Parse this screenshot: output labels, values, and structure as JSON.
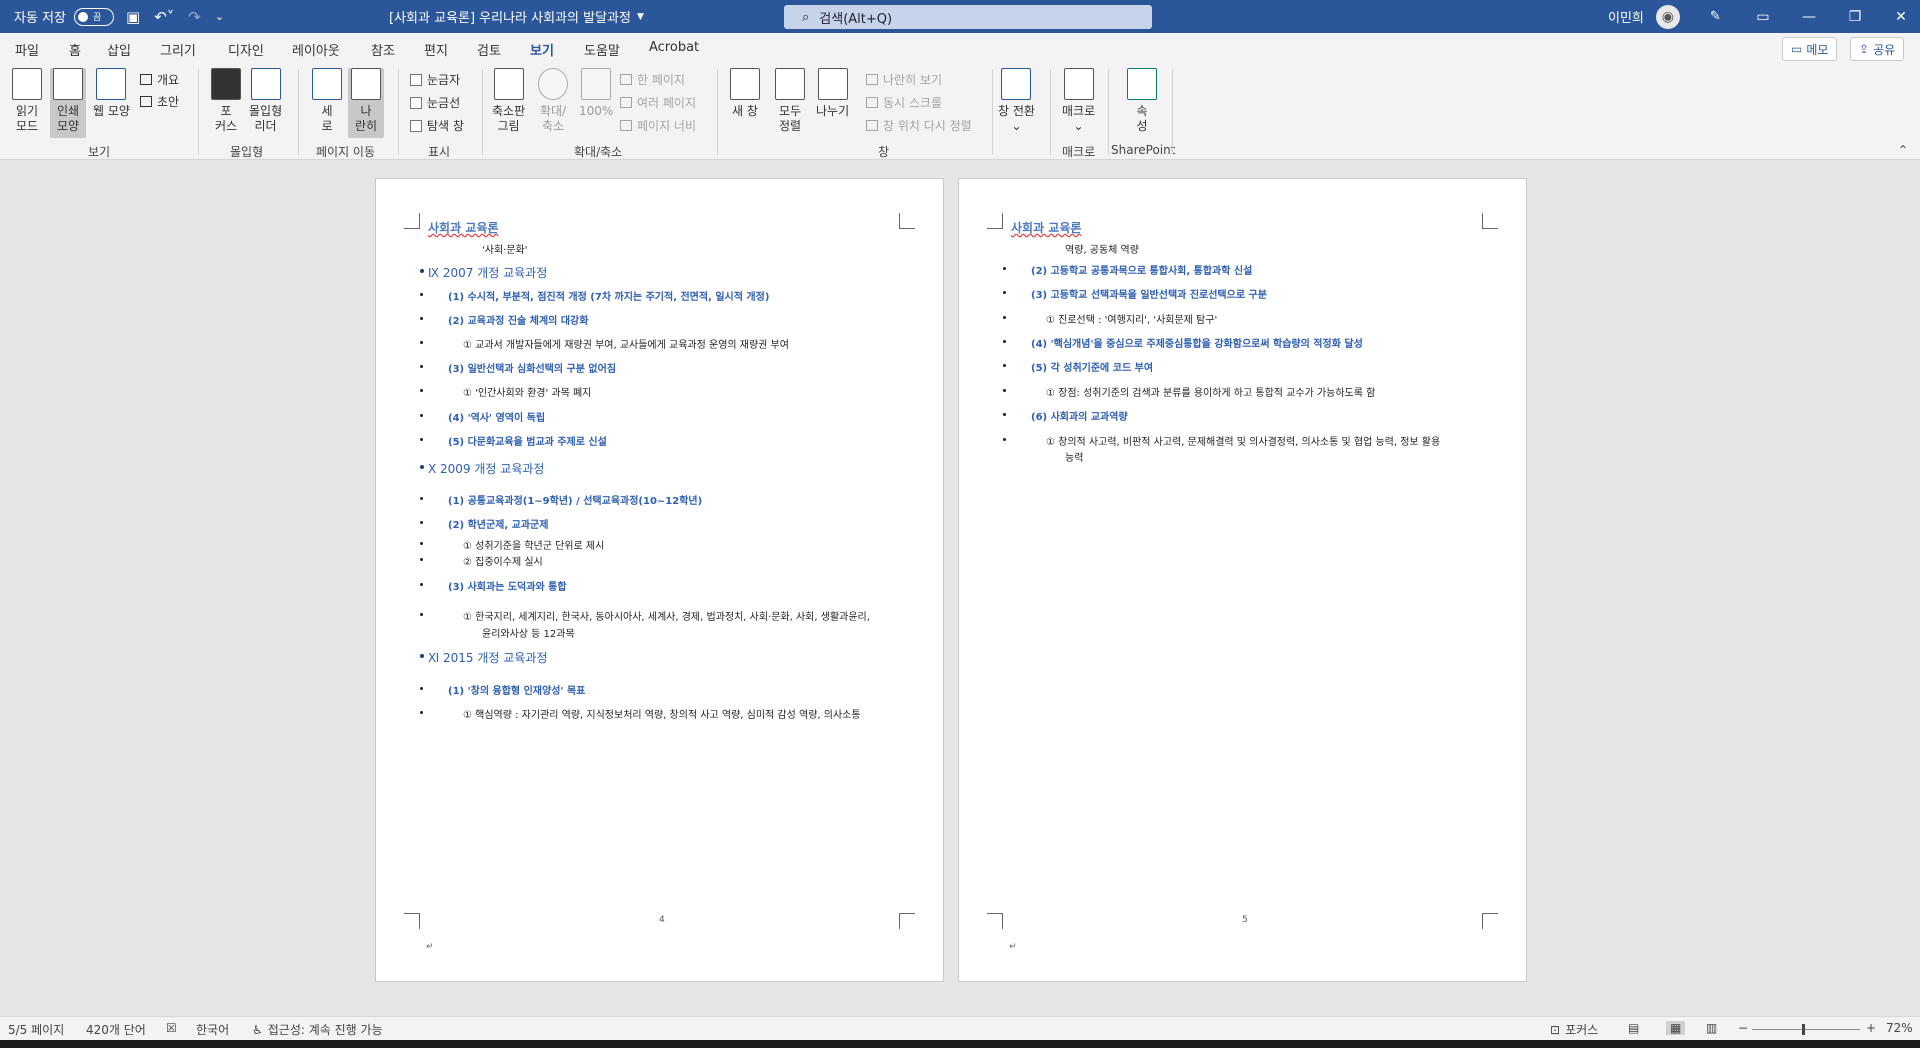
{
  "titlebar": {
    "autosave_label": "자동 저장",
    "autosave_state": "끔",
    "doc_title": "[사회과 교육론] 우리나라 사회과의 발달과정",
    "search_placeholder": "검색(Alt+Q)",
    "user_name": "이민희"
  },
  "menu": {
    "tabs": [
      "파일",
      "홈",
      "삽입",
      "그리기",
      "디자인",
      "레이아웃",
      "참조",
      "편지",
      "검토",
      "보기",
      "도움말",
      "Acrobat"
    ],
    "active_tab": "보기",
    "memo_label": "메모",
    "share_label": "공유"
  },
  "ribbon": {
    "groups": {
      "view": "보기",
      "immersive": "몰입형",
      "page_move": "페이지 이동",
      "show": "표시",
      "zoom": "확대/축소",
      "window": "창",
      "macro": "매크로",
      "sharepoint": "SharePoint"
    },
    "read_mode": [
      "읽기",
      "모드"
    ],
    "print_layout": [
      "인쇄",
      "모양"
    ],
    "web_layout": "웹 모양",
    "outline": "개요",
    "draft": "초안",
    "focus": [
      "포",
      "커스"
    ],
    "immersive_reader": [
      "몰입형",
      "리더"
    ],
    "vertical": [
      "세",
      "로"
    ],
    "side_by_side": [
      "나",
      "란히"
    ],
    "ruler": "눈금자",
    "gridlines": "눈금선",
    "nav_pane": "탐색 창",
    "zoom": [
      "축소판",
      "그림"
    ],
    "zoom2": [
      "확대/",
      "축소"
    ],
    "zoom100": "100%",
    "one_page": "한 페이지",
    "multi_page": "여러 페이지",
    "page_width": "페이지 너비",
    "new_window": "새 창",
    "arrange_all": [
      "모두",
      "정렬"
    ],
    "split": "나누기",
    "view_side": "나란히 보기",
    "sync_scroll": "동시 스크롤",
    "reset_pos": "창 위치 다시 정렬",
    "switch_window": "창 전환",
    "macro": "매크로",
    "properties": [
      "속",
      "성"
    ]
  },
  "page1": {
    "header": "사회과 교육론",
    "page_number": "4",
    "lines": [
      "'사회·문화'",
      "Ⅸ  2007 개정 교육과정",
      "(1)  수시적, 부분적, 점진적 개정 (7차 까지는 주기적, 전면적, 일시적 개정)",
      "(2)  교육과정 진술 체계의 대강화",
      "①   교과서 개발자들에게 재량권 부여, 교사들에게 교육과정 운영의 재량권 부여",
      "(3)  일반선택과 심화선택의 구분 없어짐",
      "①   '인간사회와 환경' 과목 폐지",
      "(4)  '역사' 영역이 독립",
      "(5)  다문화교육을 범교과 주제로 신설",
      "Ⅹ  2009 개정 교육과정",
      "(1)  공통교육과정(1~9학년) / 선택교육과정(10~12학년)",
      "(2)  학년군제, 교과군제",
      "①   성취기준을 학년군 단위로 제시",
      "②   집중이수제 실시",
      "(3)  사회과는 도덕과와 통합",
      "①   한국지리, 세계지리, 한국사, 동아시아사, 세계사, 경제, 법과정치, 사회·문화, 사회, 생활과윤리,",
      "윤리와사상 등 12과목",
      "Ⅺ  2015 개정 교육과정",
      "(1)  '창의 융합형 인재양성' 목표",
      "①   핵심역량 : 자기관리 역량, 지식정보처리 역량, 창의적 사고 역량, 심미적 감성 역량, 의사소통"
    ]
  },
  "page2": {
    "header": "사회과 교육론",
    "page_number": "5",
    "lines": [
      "역량, 공동체 역량",
      "(2)  고등학교 공통과목으로 통합사회, 통합과학 신설",
      "(3)  고등학교 선택과목을 일반선택과 진로선택으로 구분",
      "①   진로선택 : '여행지리', '사회문제 탐구'",
      "(4)  '핵심개념'을 중심으로 주제중심통합을 강화함으로써 학습량의 적정화 달성",
      "(5)  각 성취기준에 코드 부여",
      "①   장점: 성취기준의 검색과 분류를 용이하게 하고 통합적 교수가 가능하도록 함",
      "(6)  사회과의 교과역량",
      "①   창의적 사고력, 비판적 사고력, 문제해결력 및 의사결정력, 의사소통 및 협업 능력, 정보 활용",
      "능력"
    ]
  },
  "status": {
    "page": "5/5 페이지",
    "words": "420개 단어",
    "language": "한국어",
    "accessibility": "접근성: 계속 진행 가능",
    "focus": "포커스",
    "zoom": "72%"
  },
  "colors": {
    "title_bar": "#2b579a",
    "heading_blue": "#2e5fb0"
  }
}
